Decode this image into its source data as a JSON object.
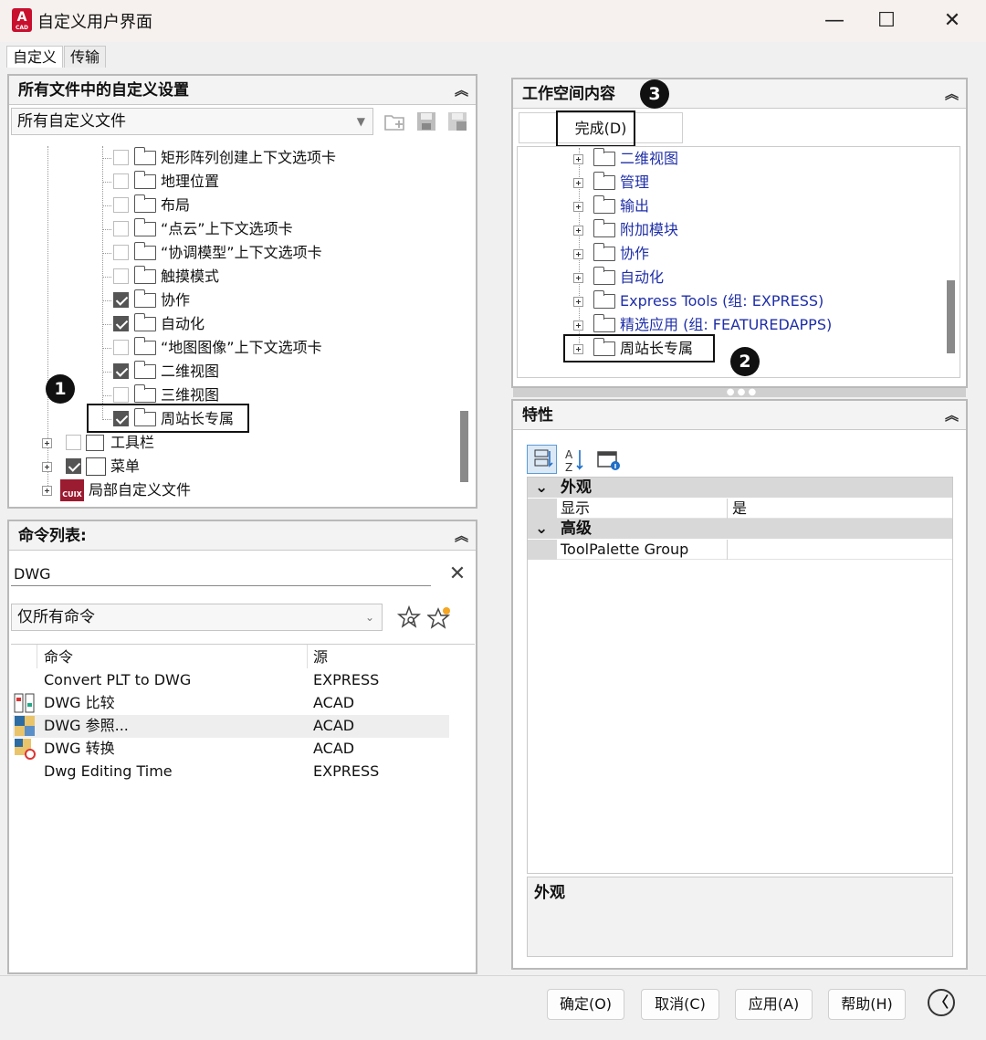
{
  "window": {
    "title": "自定义用户界面",
    "minimize": "—",
    "maximize": "☐",
    "close": "✕"
  },
  "tabs": [
    {
      "label": "自定义",
      "active": true
    },
    {
      "label": "传输",
      "active": false
    }
  ],
  "left_top": {
    "header": "所有文件中的自定义设置",
    "collapse": "︽",
    "file_combo": "所有自定义文件",
    "tree": [
      {
        "label": "矩形阵列创建上下文选项卡",
        "checked": false
      },
      {
        "label": "地理位置",
        "checked": false
      },
      {
        "label": "布局",
        "checked": false
      },
      {
        "label": "“点云”上下文选项卡",
        "checked": false
      },
      {
        "label": "“协调模型”上下文选项卡",
        "checked": false
      },
      {
        "label": "触摸模式",
        "checked": false
      },
      {
        "label": "协作",
        "checked": true
      },
      {
        "label": "自动化",
        "checked": true
      },
      {
        "label": "“地图图像”上下文选项卡",
        "checked": false
      },
      {
        "label": "二维视图",
        "checked": true
      },
      {
        "label": "三维视图",
        "checked": false
      },
      {
        "label": "周站长专属",
        "checked": true
      }
    ],
    "root_items": [
      {
        "label": "工具栏",
        "checked": false
      },
      {
        "label": "菜单",
        "checked": true
      },
      {
        "label": "局部自定义文件"
      }
    ],
    "callout": "1",
    "cuix_badge": "CUIX"
  },
  "left_bottom": {
    "header": "命令列表:",
    "collapse": "︽",
    "search_value": "DWG",
    "clear": "✕",
    "filter_combo": "仅所有命令",
    "columns": [
      "命令",
      "源"
    ],
    "rows": [
      {
        "command": "Convert PLT to DWG",
        "source": "EXPRESS"
      },
      {
        "command": "DWG 比较",
        "source": "ACAD"
      },
      {
        "command": "DWG 参照...",
        "source": "ACAD"
      },
      {
        "command": "DWG 转换",
        "source": "ACAD"
      },
      {
        "command": "Dwg Editing Time",
        "source": "EXPRESS"
      }
    ]
  },
  "right_top": {
    "header": "工作空间内容",
    "collapse": "︽",
    "done_button": "完成(D)",
    "callout_header": "3",
    "callout_tree": "2",
    "tree": [
      {
        "label": "二维视图",
        "blue": true
      },
      {
        "label": "管理",
        "blue": true
      },
      {
        "label": "输出",
        "blue": true
      },
      {
        "label": "附加模块",
        "blue": true
      },
      {
        "label": "协作",
        "blue": true
      },
      {
        "label": "自动化",
        "blue": true
      },
      {
        "label": "Express Tools (组: EXPRESS)",
        "blue": true
      },
      {
        "label": "精选应用 (组: FEATUREDAPPS)",
        "blue": true
      },
      {
        "label": "周站长专属",
        "blue": false
      }
    ]
  },
  "right_bottom": {
    "header": "特性",
    "collapse": "︽",
    "categories": [
      {
        "name": "外观",
        "rows": [
          {
            "key": "显示",
            "value": "是"
          }
        ]
      },
      {
        "name": "高级",
        "rows": [
          {
            "key": "ToolPalette Group",
            "value": ""
          }
        ]
      }
    ],
    "description_title": "外观"
  },
  "footer": {
    "ok": "确定(O)",
    "cancel": "取消(C)",
    "apply": "应用(A)",
    "help": "帮助(H)",
    "expand": "〈"
  }
}
